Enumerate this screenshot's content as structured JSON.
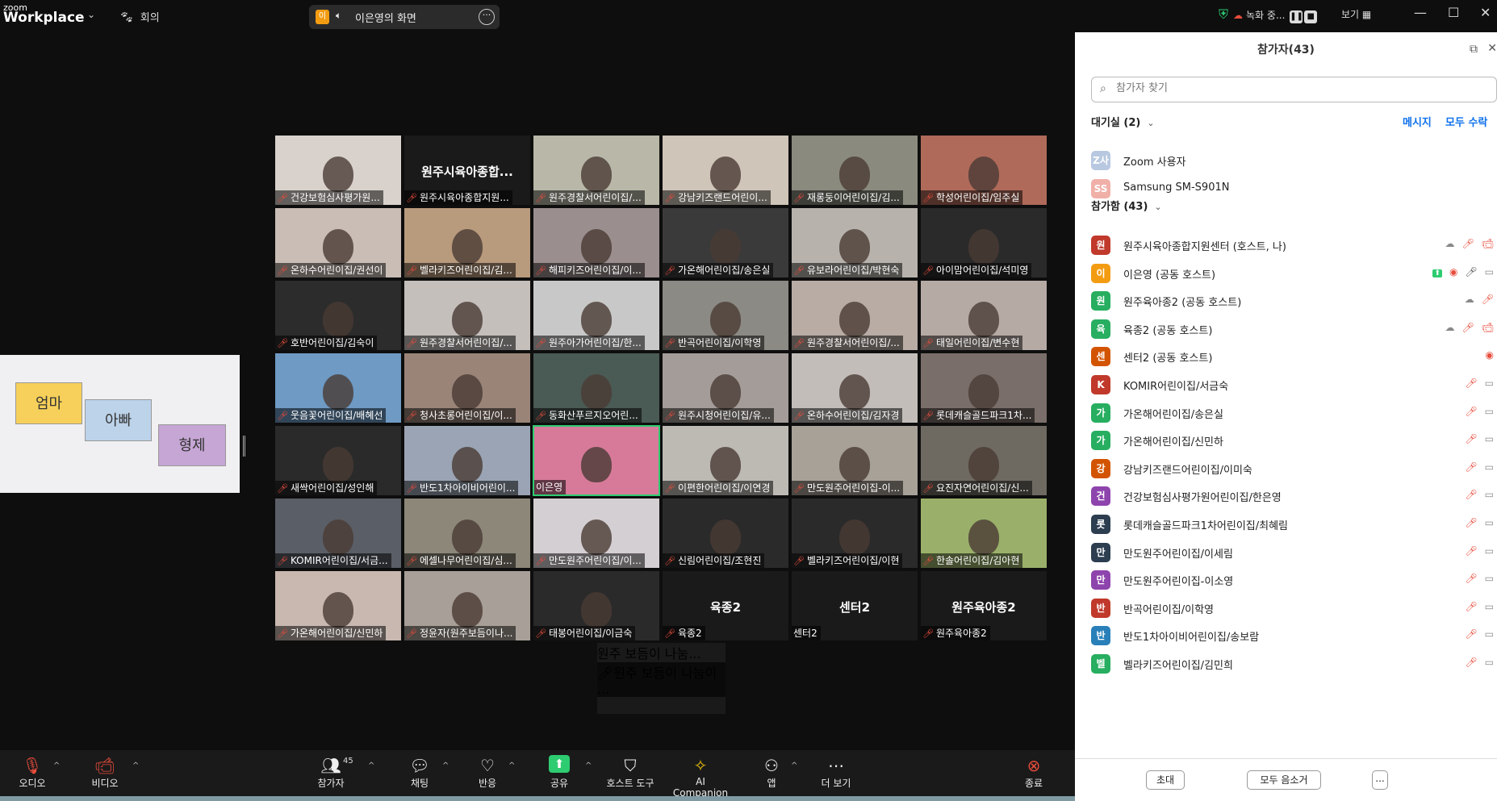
{
  "topbar": {
    "logo_top": "zoom",
    "logo_bottom": "Workplace",
    "meeting_label": "회의",
    "share_badge": "이",
    "share_label": "이은영의 화면",
    "record_label": "녹화 중...",
    "view_label": "보기"
  },
  "shared_screen": {
    "notes": [
      {
        "text": "엄마",
        "color": "#f6d05a"
      },
      {
        "text": "아빠",
        "color": "#bcd3ea"
      },
      {
        "text": "형제",
        "color": "#c6a6d4"
      }
    ]
  },
  "gallery": [
    {
      "name": "건강보험심사평가원...",
      "bg": "#d9d2cc",
      "muted": true,
      "big": ""
    },
    {
      "name": "원주시육아종합지원...",
      "bg": "#1a1a1a",
      "muted": true,
      "big": "원주시육아종합..."
    },
    {
      "name": "원주경찰서어린이집/...",
      "bg": "#b9b8a8",
      "muted": true,
      "big": ""
    },
    {
      "name": "강남키즈랜드어린이...",
      "bg": "#cfc5b8",
      "muted": true,
      "big": ""
    },
    {
      "name": "재롱둥이어린이집/김...",
      "bg": "#8a8a7e",
      "muted": true,
      "big": ""
    },
    {
      "name": "학성어린이집/임주실",
      "bg": "#b06a5a",
      "muted": true,
      "big": ""
    },
    {
      "name": "온하수어린이집/권선이",
      "bg": "#c9bdb5",
      "muted": true,
      "big": ""
    },
    {
      "name": "벨라키즈어린이집/김...",
      "bg": "#b89a7c",
      "muted": true,
      "big": ""
    },
    {
      "name": "해피키즈어린이집/이...",
      "bg": "#9b8e8e",
      "muted": true,
      "big": ""
    },
    {
      "name": "가온해어린이집/송은실",
      "bg": "#3a3a3a",
      "muted": true,
      "big": ""
    },
    {
      "name": "유보라어린이집/박현숙",
      "bg": "#b7b3ac",
      "muted": true,
      "big": ""
    },
    {
      "name": "아이맘어린이집/석미영",
      "bg": "#2a2a2a",
      "muted": true,
      "big": ""
    },
    {
      "name": "호반어린이집/김숙이",
      "bg": "#2c2c2c",
      "muted": true,
      "big": ""
    },
    {
      "name": "원주경찰서어린이집/...",
      "bg": "#c4bfbb",
      "muted": true,
      "big": ""
    },
    {
      "name": "원주아가어린이집/한...",
      "bg": "#c8c8c8",
      "muted": true,
      "big": ""
    },
    {
      "name": "반곡어린이집/이학영",
      "bg": "#8c8a84",
      "muted": true,
      "big": ""
    },
    {
      "name": "원주경찰서어린이집/...",
      "bg": "#b8aca4",
      "muted": true,
      "big": ""
    },
    {
      "name": "태일어린이집/변수현",
      "bg": "#b5aaa4",
      "muted": true,
      "big": ""
    },
    {
      "name": "웃음꽃어린이집/배혜선",
      "bg": "#6e9ac4",
      "muted": true,
      "big": ""
    },
    {
      "name": "청사초롱어린이집/이...",
      "bg": "#9a8478",
      "muted": true,
      "big": ""
    },
    {
      "name": "동화산푸르지오어린...",
      "bg": "#4a5a54",
      "muted": true,
      "big": ""
    },
    {
      "name": "원주시청어린이집/유...",
      "bg": "#a39c98",
      "muted": true,
      "big": ""
    },
    {
      "name": "온하수어린이집/김자경",
      "bg": "#c2bdb8",
      "muted": true,
      "big": ""
    },
    {
      "name": "롯데캐슬골드파크1차...",
      "bg": "#7a6e6a",
      "muted": true,
      "big": ""
    },
    {
      "name": "새싹어린이집/성인해",
      "bg": "#2a2a2a",
      "muted": true,
      "big": ""
    },
    {
      "name": "반도1차아이비어린이...",
      "bg": "#9aa4b4",
      "muted": true,
      "big": ""
    },
    {
      "name": "이은영",
      "bg": "#d77a9a",
      "muted": false,
      "big": "",
      "active": true
    },
    {
      "name": "이편한어린이집/이연경",
      "bg": "#bdbab4",
      "muted": true,
      "big": ""
    },
    {
      "name": "만도원주어린이집-이...",
      "bg": "#a7a198",
      "muted": true,
      "big": ""
    },
    {
      "name": "요진자연어린이집/신...",
      "bg": "#6e6a62",
      "muted": true,
      "big": ""
    },
    {
      "name": "KOMIR어린이집/서금...",
      "bg": "#5a5e66",
      "muted": true,
      "big": ""
    },
    {
      "name": "에셀나무어린이집/심...",
      "bg": "#8c8778",
      "muted": true,
      "big": ""
    },
    {
      "name": "만도원주어린이집/이...",
      "bg": "#d4cfd2",
      "muted": true,
      "big": ""
    },
    {
      "name": "신림어린이집/조현진",
      "bg": "#2a2a2a",
      "muted": true,
      "big": ""
    },
    {
      "name": "벨라키즈어린이집/이현",
      "bg": "#2a2a2a",
      "muted": true,
      "big": ""
    },
    {
      "name": "한솔어린이집/김아현",
      "bg": "#9ab06a",
      "muted": true,
      "big": ""
    },
    {
      "name": "가온해어린이집/신민하",
      "bg": "#c8b8b0",
      "muted": true,
      "big": ""
    },
    {
      "name": "정윤자(원주보듬이나...",
      "bg": "#a8a098",
      "muted": true,
      "big": ""
    },
    {
      "name": "태봉어린이집/이금숙",
      "bg": "#2a2a2a",
      "muted": true,
      "big": ""
    },
    {
      "name": "육종2",
      "bg": "#1a1a1a",
      "muted": true,
      "big": "육종2",
      "blank": true
    },
    {
      "name": "센터2",
      "bg": "#1a1a1a",
      "muted": false,
      "big": "센터2",
      "blank": true
    },
    {
      "name": "원주육아종2",
      "bg": "#1a1a1a",
      "muted": true,
      "big": "원주육아종2",
      "blank": true
    }
  ],
  "extra_tile": {
    "name": "원주 보듬이 나눔이 ...",
    "big": "원주 보듬이 나눔..."
  },
  "toolbar": {
    "audio": "오디오",
    "video": "비디오",
    "participants": "참가자",
    "participants_count": "45",
    "chat": "채팅",
    "react": "반응",
    "share": "공유",
    "host_tools": "호스트 도구",
    "ai": "AI Companion",
    "apps": "앱",
    "more": "더 보기",
    "end": "종료"
  },
  "panel": {
    "title": "참가자(43)",
    "search_placeholder": "참가자 찾기",
    "waiting_label": "대기실 (2)",
    "message_action": "메시지",
    "admit_all_action": "모두 수락",
    "waiting": [
      {
        "initials": "Z사",
        "name": "Zoom 사용자",
        "color": "#b8c8e0"
      },
      {
        "initials": "SS",
        "name": "Samsung SM-S901N",
        "color": "#f0b0a8"
      }
    ],
    "joined_label": "참가함 (43)",
    "participants": [
      {
        "initial": "원",
        "name": "원주시육아종합지원센터 (호스트, 나)",
        "color": "#c0392b",
        "icons": [
          "☁",
          "✕mic",
          "✕cam"
        ]
      },
      {
        "initial": "이",
        "name": "이은영 (공동 호스트)",
        "color": "#f39c12",
        "icons": [
          "share",
          "rec",
          "mic",
          "cam"
        ]
      },
      {
        "initial": "원",
        "name": "원주육아종2 (공동 호스트)",
        "color": "#27ae60",
        "icons": [
          "☁",
          "✕mic"
        ]
      },
      {
        "initial": "육",
        "name": "육종2 (공동 호스트)",
        "color": "#27ae60",
        "icons": [
          "☁",
          "✕mic",
          "✕cam"
        ]
      },
      {
        "initial": "센",
        "name": "센터2 (공동 호스트)",
        "color": "#d35400",
        "icons": [
          "rec"
        ]
      },
      {
        "initial": "K",
        "name": "KOMIR어린이집/서금숙",
        "color": "#c0392b",
        "icons": [
          "✕mic",
          "cam"
        ]
      },
      {
        "initial": "가",
        "name": "가온해어린이집/송은실",
        "color": "#27ae60",
        "icons": [
          "✕mic",
          "cam"
        ]
      },
      {
        "initial": "가",
        "name": "가온해어린이집/신민하",
        "color": "#27ae60",
        "icons": [
          "✕mic",
          "cam"
        ]
      },
      {
        "initial": "강",
        "name": "강남키즈랜드어린이집/이미숙",
        "color": "#d35400",
        "icons": [
          "✕mic",
          "cam"
        ]
      },
      {
        "initial": "건",
        "name": "건강보험심사평가원어린이집/한은영",
        "color": "#8e44ad",
        "icons": [
          "✕mic",
          "cam"
        ]
      },
      {
        "initial": "롯",
        "name": "롯데캐슬골드파크1차어린이집/최혜림",
        "color": "#2c3e50",
        "icons": [
          "✕mic",
          "cam"
        ]
      },
      {
        "initial": "만",
        "name": "만도원주어린이집/이세림",
        "color": "#2c3e50",
        "icons": [
          "✕mic",
          "cam"
        ]
      },
      {
        "initial": "만",
        "name": "만도원주어린이집-이소영",
        "color": "#8e44ad",
        "icons": [
          "✕mic",
          "cam"
        ]
      },
      {
        "initial": "반",
        "name": "반곡어린이집/이학영",
        "color": "#c0392b",
        "icons": [
          "✕mic",
          "cam"
        ]
      },
      {
        "initial": "반",
        "name": "반도1차아이비어린이집/송보람",
        "color": "#2980b9",
        "icons": [
          "✕mic",
          "cam"
        ]
      },
      {
        "initial": "벨",
        "name": "벨라키즈어린이집/김민희",
        "color": "#27ae60",
        "icons": [
          "✕mic",
          "cam"
        ]
      }
    ],
    "invite_button": "초대",
    "mute_all_button": "모두 음소거",
    "more_button": "..."
  }
}
